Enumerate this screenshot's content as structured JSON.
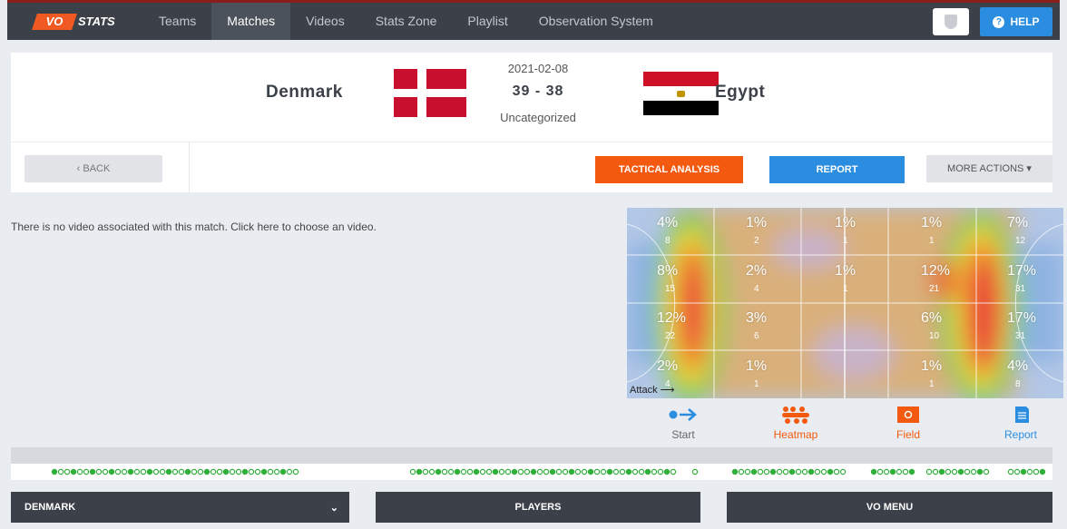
{
  "nav": {
    "logo_vo": "VO",
    "logo_stats": "STATS",
    "items": [
      {
        "label": "Teams"
      },
      {
        "label": "Matches"
      },
      {
        "label": "Videos"
      },
      {
        "label": "Stats Zone"
      },
      {
        "label": "Playlist"
      },
      {
        "label": "Observation System"
      }
    ],
    "help_label": "HELP"
  },
  "match": {
    "home_team": "Denmark",
    "away_team": "Egypt",
    "date": "2021-02-08",
    "score": "39 - 38",
    "category": "Uncategorized"
  },
  "actions": {
    "back": "‹  BACK",
    "tactical": "TACTICAL ANALYSIS",
    "report": "REPORT",
    "more": "MORE ACTIONS  ▾"
  },
  "video_message": "There is no video associated with this match. Click here to choose an video.",
  "heatmap": {
    "attack_label": "Attack",
    "rows": [
      [
        {
          "pct": "4%",
          "count": "8"
        },
        {
          "pct": "1%",
          "count": "2"
        },
        {
          "pct": "1%",
          "count": "1"
        },
        {
          "pct": "1%",
          "count": "1"
        },
        {
          "pct": "7%",
          "count": "12"
        }
      ],
      [
        {
          "pct": "8%",
          "count": "15"
        },
        {
          "pct": "2%",
          "count": "4"
        },
        {
          "pct": "1%",
          "count": "1"
        },
        {
          "pct": "12%",
          "count": "21"
        },
        {
          "pct": "17%",
          "count": "31"
        }
      ],
      [
        {
          "pct": "12%",
          "count": "22"
        },
        {
          "pct": "3%",
          "count": "6"
        },
        {
          "pct": "",
          "count": ""
        },
        {
          "pct": "6%",
          "count": "10"
        },
        {
          "pct": "17%",
          "count": "31"
        }
      ],
      [
        {
          "pct": "2%",
          "count": "4"
        },
        {
          "pct": "1%",
          "count": "1"
        },
        {
          "pct": "",
          "count": ""
        },
        {
          "pct": "1%",
          "count": "1"
        },
        {
          "pct": "4%",
          "count": "8"
        }
      ]
    ]
  },
  "tools": [
    {
      "label": "Start",
      "icon": "arrow-right-icon"
    },
    {
      "label": "Heatmap",
      "icon": "heatmap-icon"
    },
    {
      "label": "Field",
      "icon": "field-icon"
    },
    {
      "label": "Report",
      "icon": "document-icon"
    }
  ],
  "bottom": {
    "team_select": "DENMARK",
    "players": "PLAYERS",
    "vo_menu": "VO MENU"
  },
  "colors": {
    "nav_bg": "#3b4049",
    "accent_orange": "#f35a0f",
    "accent_blue": "#2b8de0",
    "timeline_dot": "#2fae3a"
  }
}
